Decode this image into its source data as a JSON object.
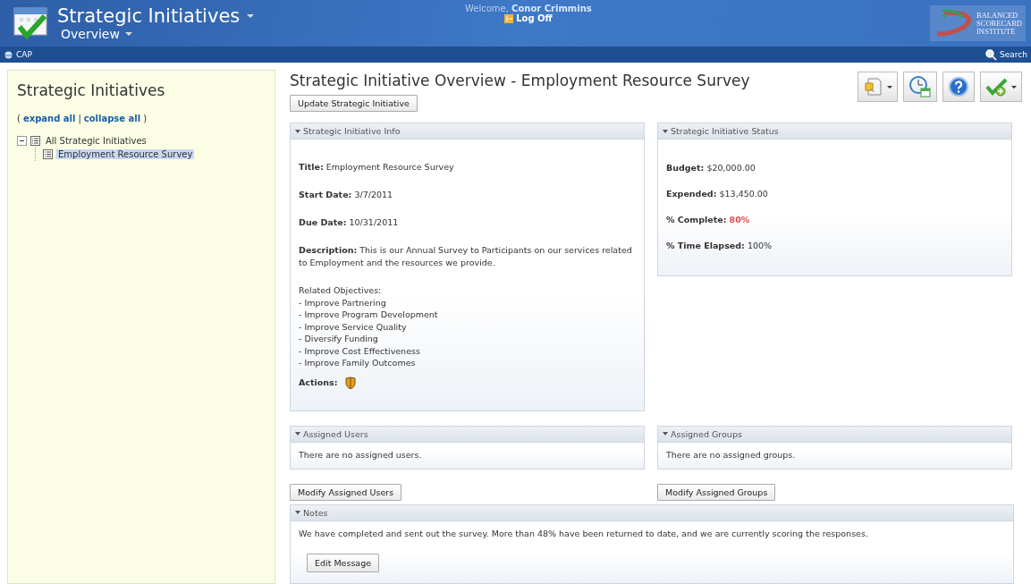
{
  "header": {
    "title": "Strategic Initiatives",
    "subtitle": "Overview",
    "welcome": "Welcome,",
    "user": "Conor Crimmins",
    "logoff": "Log Off",
    "logo_lines": [
      "BALANCED",
      "SCORECARD",
      "INSTITUTE"
    ]
  },
  "nav": {
    "site": "CAP",
    "search": "Search"
  },
  "sidebar": {
    "title": "Strategic Initiatives",
    "open_paren": "(",
    "expand": "expand all",
    "separator": "|",
    "collapse": "collapse all",
    "close_paren": ")",
    "tree": [
      {
        "label": "All Strategic Initiatives",
        "expanded": true,
        "selected": false,
        "children": [
          {
            "label": "Employment Resource Survey",
            "selected": true
          }
        ]
      }
    ]
  },
  "main": {
    "title": "Strategic Initiative Overview - Employment Resource Survey",
    "update_button": "Update Strategic Initiative",
    "toolbar": [
      {
        "kind": "document",
        "caret": true
      },
      {
        "kind": "clock",
        "caret": false
      },
      {
        "kind": "help",
        "caret": false
      },
      {
        "kind": "check",
        "caret": true
      }
    ],
    "info": {
      "heading": "Strategic Initiative Info",
      "fields": [
        "**Title:** Employment Resource Survey",
        "**Start Date:** 3/7/2011",
        "**Due Date:** 10/31/2011",
        "**Description:**  This is our Annual Survey to Participants on our services related to Employment and the resources we provide."
      ],
      "objectives_heading": "Related Objectives:",
      "objectives": [
        "- Improve Partnering",
        "- Improve Program Development",
        "- Improve Service Quality",
        "- Diversify Funding",
        "- Improve Cost Effectiveness",
        "- Improve Family Outcomes"
      ],
      "actions_label": "Actions:"
    },
    "status": {
      "heading": "Strategic Initiative Status",
      "fields": [
        {
          "label": "Budget:",
          "value": "$20,000.00"
        },
        {
          "label": "Expended:",
          "value": "$13,450.00"
        },
        {
          "label": "% Complete:",
          "value": "80%",
          "color": "#e8474f"
        },
        {
          "label": "% Time Elapsed:",
          "value": "100%"
        }
      ]
    },
    "users": {
      "heading": "Assigned Users",
      "text": "There are no assigned users.",
      "button": "Modify Assigned Users"
    },
    "groups": {
      "heading": "Assigned Groups",
      "text": "There are no assigned groups.",
      "button": "Modify Assigned Groups"
    },
    "notes": {
      "heading": "Notes",
      "text": "We have completed and sent out the survey. More than 48% have been returned to date, and we are currently scoring the responses.",
      "button": "Edit Message"
    }
  }
}
